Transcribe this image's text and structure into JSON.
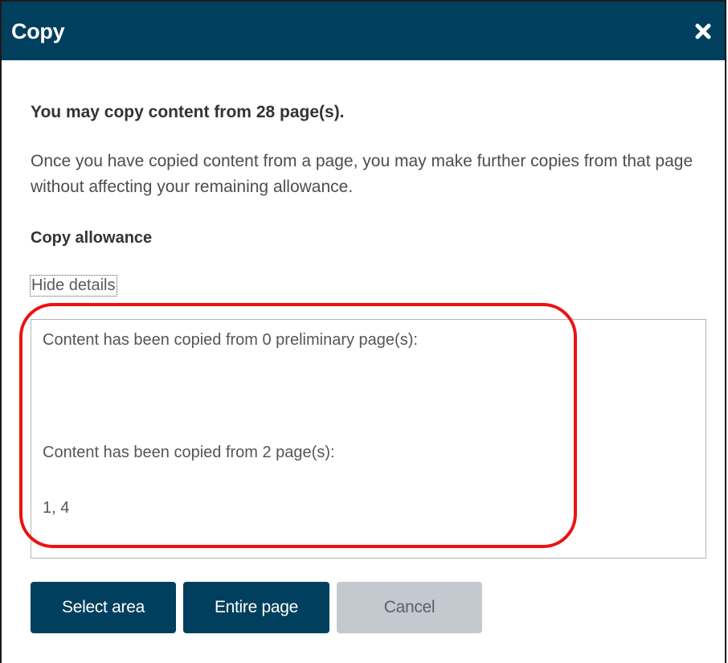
{
  "dialog": {
    "title": "Copy",
    "close_icon": "close-icon",
    "headline": "You may copy content from 28 page(s).",
    "info": "Once you have copied content from a page, you may make further copies from that page without affecting your remaining allowance.",
    "allowance_heading": "Copy allowance",
    "hide_details_label": "Hide details",
    "details": {
      "preliminary_line": "Content has been copied from 0 preliminary page(s):",
      "preliminary_pages": "",
      "pages_line": "Content has been copied from 2 page(s):",
      "pages_list": "1, 4"
    },
    "buttons": {
      "select_area": "Select area",
      "entire_page": "Entire page",
      "cancel": "Cancel"
    }
  },
  "colors": {
    "titlebar": "#013f5e",
    "primary_button": "#013f5e",
    "disabled_button": "#c3c9ce",
    "highlight": "#ee1111"
  }
}
